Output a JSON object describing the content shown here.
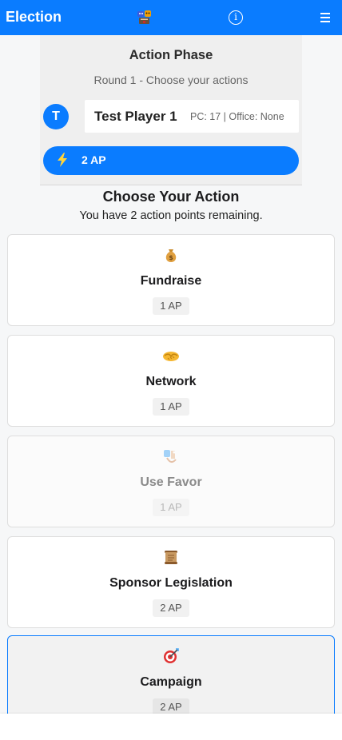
{
  "header": {
    "title": "Election",
    "logo_icon": "masks-ballot-icon",
    "info_icon": "info-circle-icon",
    "menu_icon": "hamburger-menu-icon",
    "accent_color": "#0a7cff"
  },
  "phase": {
    "title": "Action Phase",
    "subtitle": "Round 1 - Choose your actions"
  },
  "player": {
    "avatar_initial": "T",
    "name": "Test Player 1",
    "meta": "PC: 17 | Office: None"
  },
  "ap": {
    "icon": "lightning-bolt-icon",
    "label": "2 AP"
  },
  "choose": {
    "title": "Choose Your Action",
    "subtitle": "You have 2 action points remaining."
  },
  "actions": [
    {
      "name": "Fundraise",
      "cost": "1 AP",
      "icon": "money-bag-icon",
      "state": "enabled"
    },
    {
      "name": "Network",
      "cost": "1 AP",
      "icon": "handshake-icon",
      "state": "enabled"
    },
    {
      "name": "Use Favor",
      "cost": "1 AP",
      "icon": "favor-hands-icon",
      "state": "disabled"
    },
    {
      "name": "Sponsor Legislation",
      "cost": "2 AP",
      "icon": "scroll-icon",
      "state": "enabled"
    },
    {
      "name": "Campaign",
      "cost": "2 AP",
      "icon": "bullseye-dart-icon",
      "state": "selected"
    }
  ]
}
